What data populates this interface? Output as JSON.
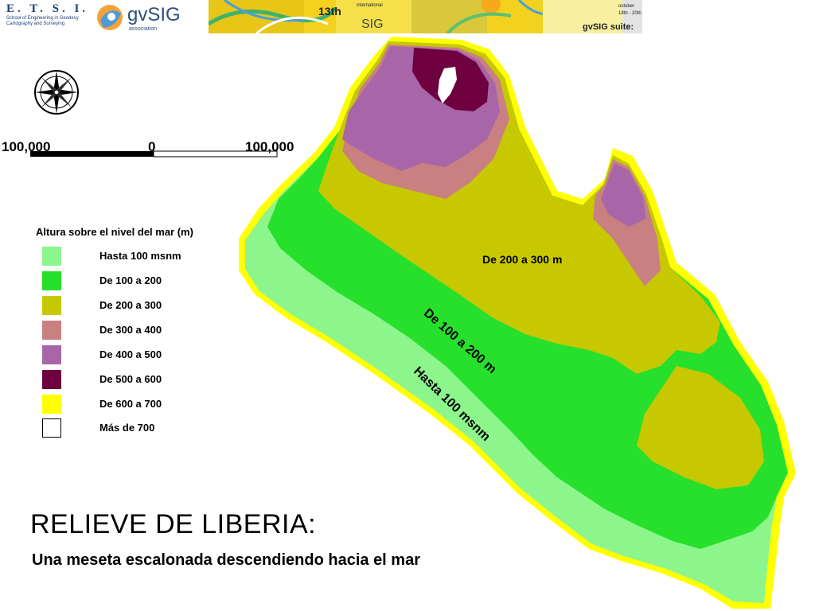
{
  "header": {
    "school": {
      "name": "E. T. S. I.",
      "line1": "School of Engineering in Geodesy",
      "line2": "Cartography and Surveying"
    },
    "association": {
      "name": "gvSIG",
      "subtitle": "association"
    },
    "conference": {
      "edition": "13th",
      "international": "international",
      "name": "SIG",
      "suite": "gvSIG suite:",
      "month": "october",
      "dates": "18th - 20th"
    }
  },
  "map": {
    "title": "RELIEVE DE LIBERIA:",
    "subtitle": "Una meseta escalonada descendiendo hacia el mar",
    "legend": {
      "title": "Altura sobre el nivel del mar (m)",
      "items": [
        {
          "label": "Hasta 100 msnm",
          "color": "#8cf58c"
        },
        {
          "label": "De 100 a 200",
          "color": "#26e02c"
        },
        {
          "label": "De 200 a 300",
          "color": "#c8c800"
        },
        {
          "label": "De 300 a 400",
          "color": "#c98080"
        },
        {
          "label": "De 400 a 500",
          "color": "#a866a8"
        },
        {
          "label": "De 500 a 600",
          "color": "#6e0040"
        },
        {
          "label": "De 600 a 700",
          "color": "#ffff00"
        },
        {
          "label": "Más de 700",
          "color": "#ffffff"
        }
      ]
    },
    "scale": {
      "left": "100,000",
      "center": "0",
      "right": "100,000"
    },
    "zone_labels": {
      "plateau": "De 200 a 300 m",
      "middle": "De 100 a 200 m",
      "coast": "Hasta 100 msnm"
    },
    "icons": {
      "compass": "compass-rose-icon"
    }
  }
}
